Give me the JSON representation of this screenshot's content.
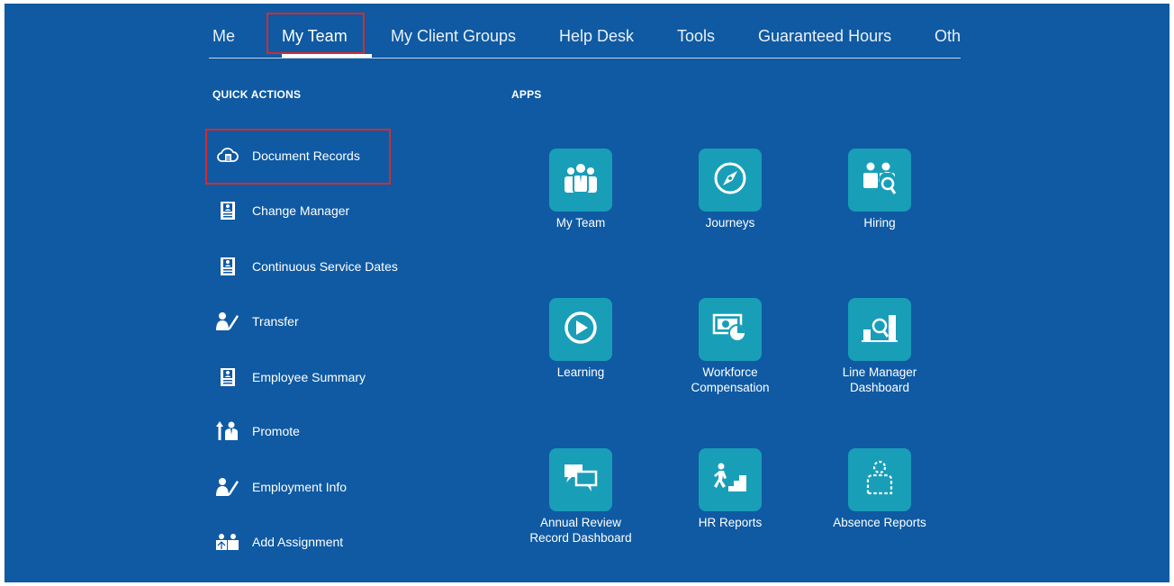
{
  "nav": {
    "tabs": [
      {
        "label": "Me"
      },
      {
        "label": "My Team"
      },
      {
        "label": "My Client Groups"
      },
      {
        "label": "Help Desk"
      },
      {
        "label": "Tools"
      },
      {
        "label": "Guaranteed Hours"
      },
      {
        "label": "Oth"
      }
    ],
    "active_tab": "My Team"
  },
  "quick_actions": {
    "title": "QUICK ACTIONS",
    "items": [
      {
        "label": "Document Records",
        "icon": "cloud-document-icon"
      },
      {
        "label": "Change Manager",
        "icon": "id-badge-icon"
      },
      {
        "label": "Continuous Service Dates",
        "icon": "id-badge-icon"
      },
      {
        "label": "Transfer",
        "icon": "person-edit-icon"
      },
      {
        "label": "Employee Summary",
        "icon": "id-badge-icon"
      },
      {
        "label": "Promote",
        "icon": "person-up-arrow-icon"
      },
      {
        "label": "Employment Info",
        "icon": "person-edit-icon"
      },
      {
        "label": "Add Assignment",
        "icon": "people-add-icon"
      }
    ]
  },
  "apps": {
    "title": "APPS",
    "items": [
      {
        "line1": "My Team",
        "line2": "",
        "icon": "team-icon"
      },
      {
        "line1": "Journeys",
        "line2": "",
        "icon": "compass-icon"
      },
      {
        "line1": "Hiring",
        "line2": "",
        "icon": "people-search-icon"
      },
      {
        "line1": "Learning",
        "line2": "",
        "icon": "play-circle-icon"
      },
      {
        "line1": "Workforce",
        "line2": "Compensation",
        "icon": "money-chart-icon"
      },
      {
        "line1": "Line Manager",
        "line2": "Dashboard",
        "icon": "chart-search-icon"
      },
      {
        "line1": "Annual Review",
        "line2": "Record Dashboard",
        "icon": "chat-bubbles-icon"
      },
      {
        "line1": "HR Reports",
        "line2": "",
        "icon": "person-stairs-icon"
      },
      {
        "line1": "Absence Reports",
        "line2": "",
        "icon": "dashed-person-icon"
      }
    ]
  },
  "colors": {
    "background": "#0f5aa3",
    "tile": "#199eb8",
    "highlight": "#d52b2b"
  }
}
